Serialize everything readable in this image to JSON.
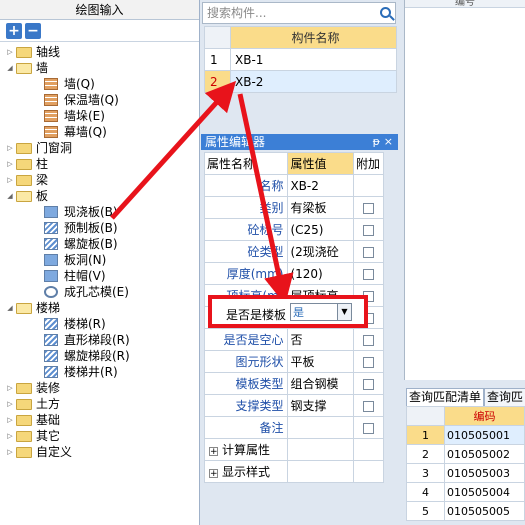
{
  "left": {
    "title": "绘图输入",
    "toolbar": {
      "expand": "+",
      "collapse": "−"
    },
    "tree": [
      {
        "label": "轴线",
        "level": 0,
        "kind": "folder",
        "exp": "▷"
      },
      {
        "label": "墙",
        "level": 0,
        "kind": "folder-open",
        "exp": "◢"
      },
      {
        "label": "墙(Q)",
        "level": 1,
        "kind": "brick"
      },
      {
        "label": "保温墙(Q)",
        "level": 1,
        "kind": "brick"
      },
      {
        "label": "墙垛(E)",
        "level": 1,
        "kind": "brick"
      },
      {
        "label": "幕墙(Q)",
        "level": 1,
        "kind": "brick"
      },
      {
        "label": "门窗洞",
        "level": 0,
        "kind": "folder",
        "exp": "▷"
      },
      {
        "label": "柱",
        "level": 0,
        "kind": "folder",
        "exp": "▷"
      },
      {
        "label": "梁",
        "level": 0,
        "kind": "folder",
        "exp": "▷"
      },
      {
        "label": "板",
        "level": 0,
        "kind": "folder-open",
        "exp": "◢"
      },
      {
        "label": "现浇板(B)",
        "level": 1,
        "kind": "blue"
      },
      {
        "label": "预制板(B)",
        "level": 1,
        "kind": "stair"
      },
      {
        "label": "螺旋板(B)",
        "level": 1,
        "kind": "stair"
      },
      {
        "label": "板洞(N)",
        "level": 1,
        "kind": "blue"
      },
      {
        "label": "柱帽(V)",
        "level": 1,
        "kind": "blue"
      },
      {
        "label": "成孔芯模(E)",
        "level": 1,
        "kind": "ring"
      },
      {
        "label": "楼梯",
        "level": 0,
        "kind": "folder-open",
        "exp": "◢"
      },
      {
        "label": "楼梯(R)",
        "level": 1,
        "kind": "stair"
      },
      {
        "label": "直形梯段(R)",
        "level": 1,
        "kind": "stair"
      },
      {
        "label": "螺旋梯段(R)",
        "level": 1,
        "kind": "stair"
      },
      {
        "label": "楼梯井(R)",
        "level": 1,
        "kind": "stair"
      },
      {
        "label": "装修",
        "level": 0,
        "kind": "folder",
        "exp": "▷"
      },
      {
        "label": "土方",
        "level": 0,
        "kind": "folder",
        "exp": "▷"
      },
      {
        "label": "基础",
        "level": 0,
        "kind": "folder",
        "exp": "▷"
      },
      {
        "label": "其它",
        "level": 0,
        "kind": "folder",
        "exp": "▷"
      },
      {
        "label": "自定义",
        "level": 0,
        "kind": "folder",
        "exp": "▷"
      }
    ]
  },
  "search": {
    "placeholder": "搜索构件..."
  },
  "components": {
    "header": "构件名称",
    "rows": [
      {
        "num": "1",
        "name": "XB-1"
      },
      {
        "num": "2",
        "name": "XB-2"
      }
    ]
  },
  "properties": {
    "title": "属性编辑器",
    "pin": "ᵽ",
    "close": "×",
    "headers": {
      "name": "属性名称",
      "value": "属性值",
      "extra": "附加"
    },
    "rows": [
      {
        "name": "名称",
        "value": "XB-2",
        "check": false
      },
      {
        "name": "类别",
        "value": "有梁板",
        "check": true
      },
      {
        "name": "砼标号",
        "value": "(C25)",
        "check": true
      },
      {
        "name": "砼类型",
        "value": "(2现浇砼",
        "check": true
      },
      {
        "name": "厚度(mm)",
        "value": "(120)",
        "check": true
      },
      {
        "name": "顶标高(m)",
        "value": "层顶标高",
        "check": true
      },
      {
        "name": "是否是楼板",
        "value": "",
        "check": true
      },
      {
        "name": "是否是空心",
        "value": "否",
        "check": true
      },
      {
        "name": "图元形状",
        "value": "平板",
        "check": true
      },
      {
        "name": "模板类型",
        "value": "组合钢模",
        "check": true
      },
      {
        "name": "支撑类型",
        "value": "钢支撑",
        "check": true
      },
      {
        "name": "备注",
        "value": "",
        "check": true
      }
    ],
    "groups": [
      "计算属性",
      "显示样式"
    ]
  },
  "callout": {
    "label": "是否是楼板",
    "value": "是"
  },
  "right": {
    "top_header": "编号",
    "tabs": [
      "查询匹配清单",
      "查询匹"
    ],
    "code_header": "编码",
    "rows": [
      {
        "num": "1",
        "code": "010505001"
      },
      {
        "num": "2",
        "code": "010505002"
      },
      {
        "num": "3",
        "code": "010505003"
      },
      {
        "num": "4",
        "code": "010505004"
      },
      {
        "num": "5",
        "code": "010505005"
      }
    ]
  },
  "colors": {
    "accent": "#3c7fd6",
    "highlight": "#fadc8a",
    "annotation": "#e8131b"
  }
}
